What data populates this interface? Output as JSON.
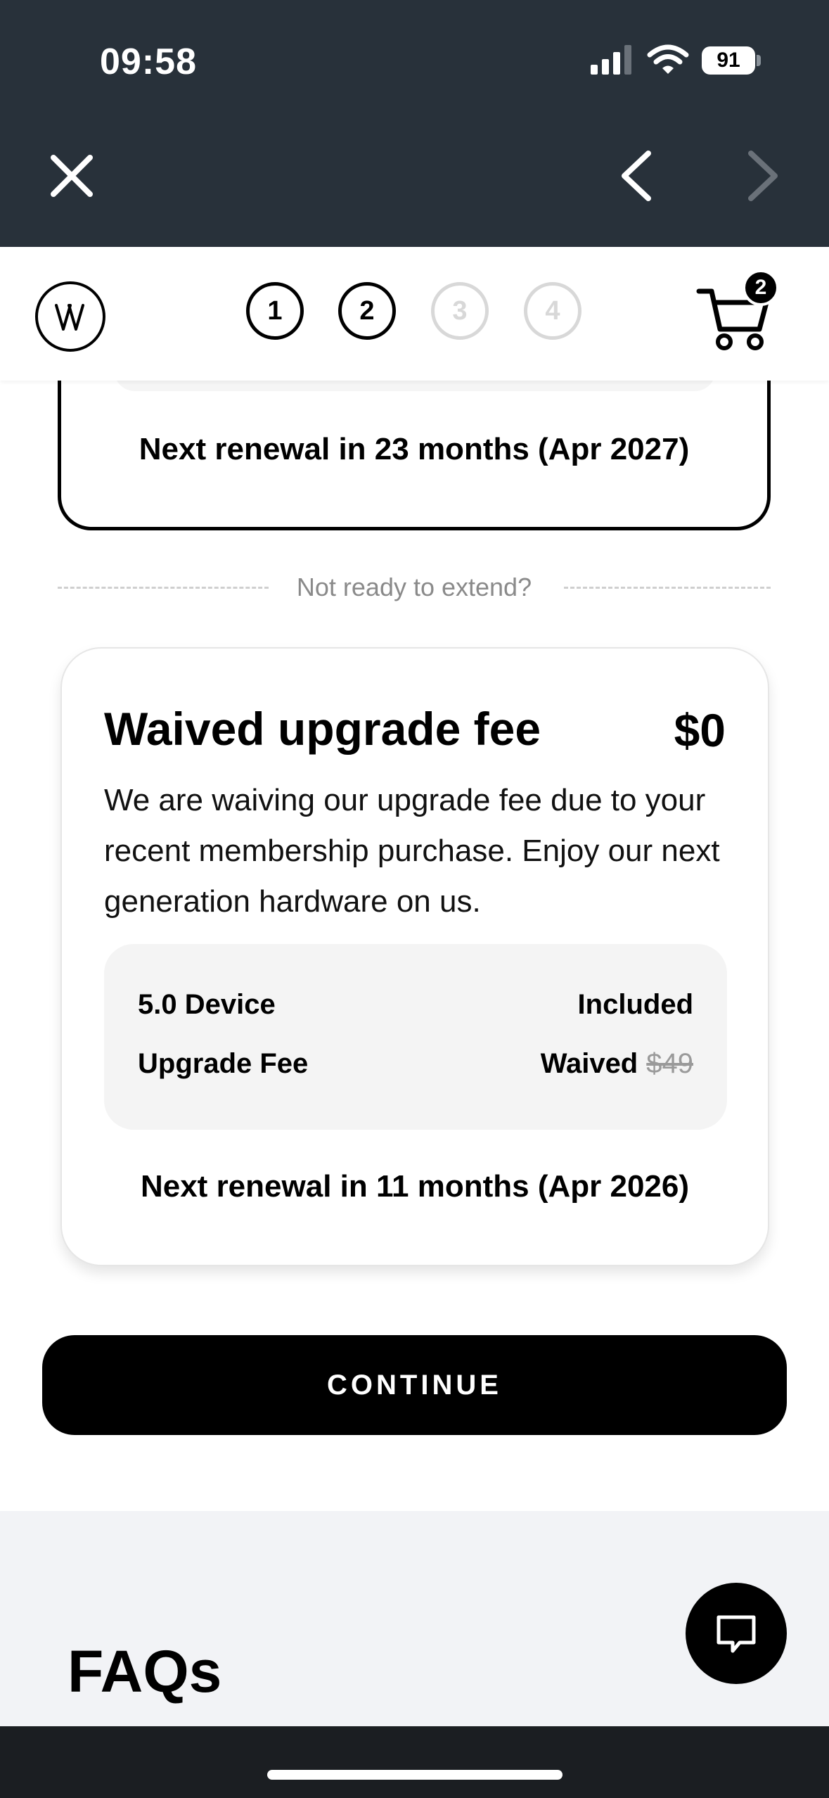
{
  "status_bar": {
    "time": "09:58",
    "battery": "91"
  },
  "browser_nav": {
    "close_icon": "close-icon",
    "back_icon": "chevron-left-icon",
    "forward_icon": "chevron-right-icon"
  },
  "header": {
    "logo_icon": "whoop-logo-icon",
    "steps": [
      "1",
      "2",
      "3",
      "4"
    ],
    "active_steps": 2,
    "cart_count": "2"
  },
  "previous_plan": {
    "renewal": "Next renewal in 23 months (Apr 2027)"
  },
  "divider": {
    "text": "Not ready to extend?"
  },
  "offer": {
    "title": "Waived upgrade fee",
    "price": "$0",
    "description": "We are waiving our upgrade fee due to your recent membership purchase. Enjoy our next generation hardware on us.",
    "items": [
      {
        "label": "5.0 Device",
        "value": "Included",
        "old_value": ""
      },
      {
        "label": "Upgrade Fee",
        "value": "Waived",
        "old_value": "$49"
      }
    ],
    "renewal": "Next renewal in 11 months (Apr 2026)"
  },
  "continue_label": "CONTINUE",
  "faq": {
    "title": "FAQs"
  },
  "colors": {
    "topbar": "#28313a",
    "primary": "#000000",
    "disabled_step": "#d8d8d8",
    "card_inner": "#f4f4f4",
    "faq_bg": "#f2f3f6"
  }
}
